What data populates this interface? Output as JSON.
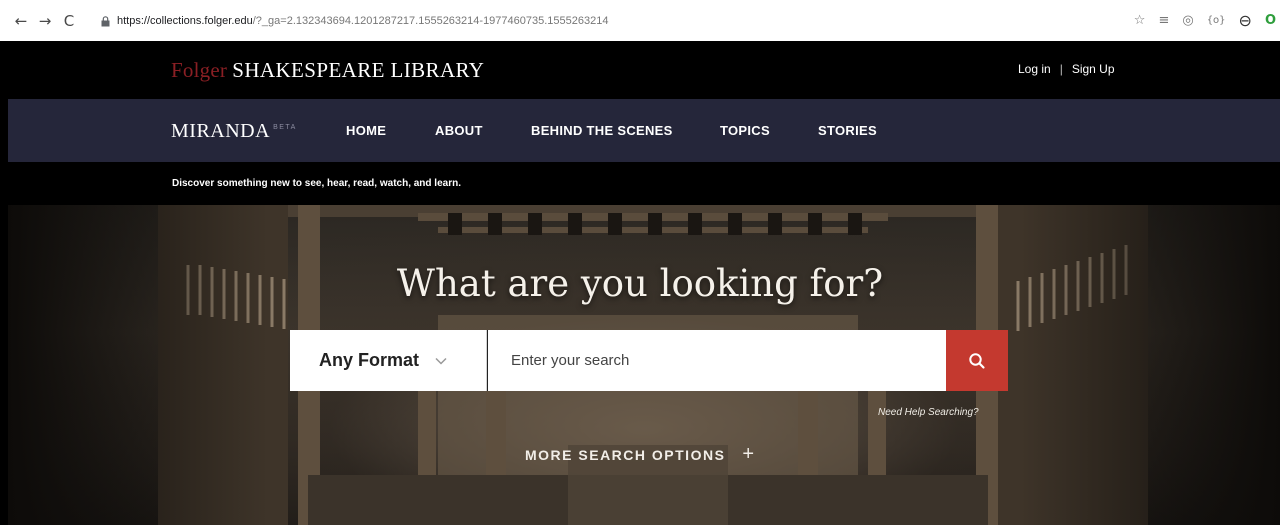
{
  "browser": {
    "url_main": "https://collections.folger.edu",
    "url_rest": "/?_ga=2.132343694.1201287217.1555263214-1977460735.1555263214"
  },
  "header": {
    "logo_folger": "Folger",
    "logo_rest": "SHAKESPEARE LIBRARY",
    "login": "Log in",
    "separator": "|",
    "signup": "Sign Up"
  },
  "nav": {
    "brand": "MIRANDA",
    "brand_badge": "BETA",
    "items": [
      {
        "label": "HOME"
      },
      {
        "label": "ABOUT"
      },
      {
        "label": "BEHIND THE SCENES"
      },
      {
        "label": "TOPICS"
      },
      {
        "label": "STORIES"
      }
    ]
  },
  "tagline": "Discover something new to see, hear, read, watch, and learn.",
  "hero": {
    "title": "What are you looking for?",
    "format_value": "Any Format",
    "search_placeholder": "Enter your search",
    "help_link": "Need Help Searching?",
    "more_options": "MORE SEARCH OPTIONS",
    "more_options_icon": "+"
  },
  "colors": {
    "brand_red": "#8a1f24",
    "nav_bg": "#25263a",
    "search_button": "#c4392f"
  }
}
